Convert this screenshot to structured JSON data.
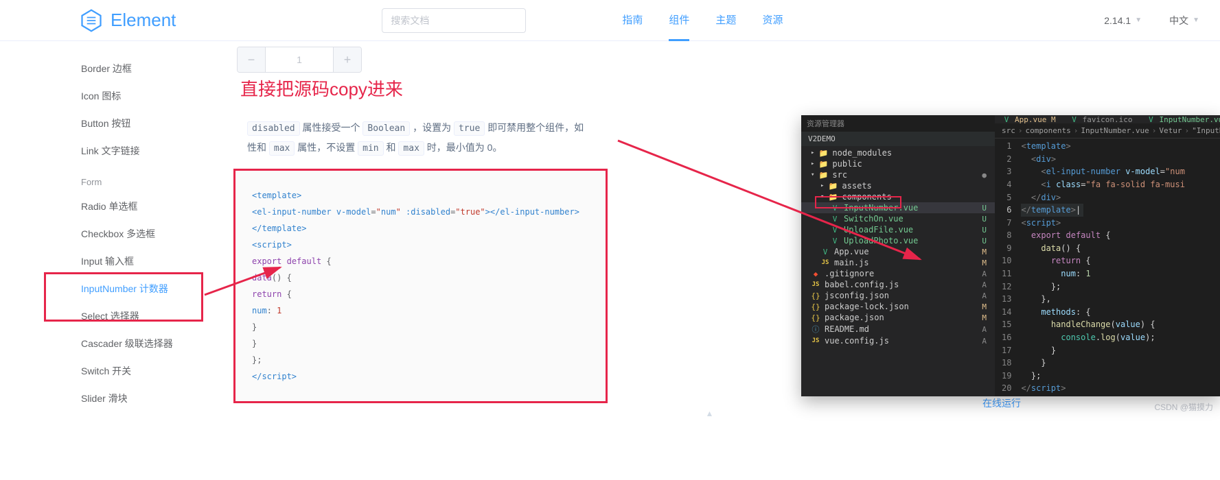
{
  "header": {
    "brand": "Element",
    "search_placeholder": "搜索文档",
    "nav": [
      {
        "label": "指南",
        "active": false
      },
      {
        "label": "组件",
        "active": true
      },
      {
        "label": "主题",
        "active": false
      },
      {
        "label": "资源",
        "active": false
      }
    ],
    "version": "2.14.1",
    "language": "中文"
  },
  "sidebar": {
    "items": [
      {
        "label": "Border 边框",
        "type": "item"
      },
      {
        "label": "Icon 图标",
        "type": "item"
      },
      {
        "label": "Button 按钮",
        "type": "item"
      },
      {
        "label": "Link 文字链接",
        "type": "item"
      },
      {
        "label": "Form",
        "type": "group"
      },
      {
        "label": "Radio 单选框",
        "type": "item"
      },
      {
        "label": "Checkbox 多选框",
        "type": "item"
      },
      {
        "label": "Input 输入框",
        "type": "item"
      },
      {
        "label": "InputNumber 计数器",
        "type": "item",
        "active": true
      },
      {
        "label": "Select 选择器",
        "type": "item"
      },
      {
        "label": "Cascader 级联选择器",
        "type": "item"
      },
      {
        "label": "Switch 开关",
        "type": "item"
      },
      {
        "label": "Slider 滑块",
        "type": "item"
      }
    ]
  },
  "main": {
    "counter_value": "1",
    "desc_parts": {
      "p1": "属性接受一个",
      "p2": "，设置为",
      "p3": "即可禁用整个组件，如",
      "p4": "性和",
      "p5": "属性，不设置",
      "p6": "和",
      "p7": "时，最小值为 0。",
      "c_disabled": "disabled",
      "c_boolean": "Boolean",
      "c_true": "true",
      "c_max": "max",
      "c_min": "min",
      "c_max2": "max"
    },
    "code_lines": [
      "<template>",
      "  <el-input-number v-model=\"num\" :disabled=\"true\"></el-input-number>",
      "</template>",
      "<script>",
      "  export default {",
      "    data() {",
      "      return {",
      "        num: 1",
      "      }",
      "    }",
      "  };",
      "</script>"
    ],
    "online_run": "在线运行",
    "csdn": "CSDN @猫摸力"
  },
  "annotation": {
    "title": "直接把源码copy进来"
  },
  "vscode": {
    "title_hint": "资源管理器",
    "project": "V2DEMO",
    "tree": [
      {
        "name": "node_modules",
        "icon": "folder",
        "indent": 1,
        "expand": "▸"
      },
      {
        "name": "public",
        "icon": "folder",
        "indent": 1,
        "expand": "▸"
      },
      {
        "name": "src",
        "icon": "folder",
        "indent": 1,
        "expand": "▾",
        "badge": "●"
      },
      {
        "name": "assets",
        "icon": "folder",
        "indent": 2,
        "expand": "▸"
      },
      {
        "name": "components",
        "icon": "folder",
        "indent": 2,
        "expand": "▾"
      },
      {
        "name": "InputNumber.vue",
        "icon": "vue",
        "indent": 3,
        "status": "u",
        "badge": "U",
        "selected": true
      },
      {
        "name": "SwitchOn.vue",
        "icon": "vue",
        "indent": 3,
        "status": "u",
        "badge": "U"
      },
      {
        "name": "UploadFile.vue",
        "icon": "vue",
        "indent": 3,
        "status": "u",
        "badge": "U"
      },
      {
        "name": "UploadPhoto.vue",
        "icon": "vue",
        "indent": 3,
        "status": "u",
        "badge": "U"
      },
      {
        "name": "App.vue",
        "icon": "vue",
        "indent": 2,
        "status": "m",
        "badge": "M"
      },
      {
        "name": "main.js",
        "icon": "js",
        "indent": 2,
        "status": "m",
        "badge": "M"
      },
      {
        "name": ".gitignore",
        "icon": "git",
        "indent": 1,
        "status": "a",
        "badge": "A"
      },
      {
        "name": "babel.config.js",
        "icon": "js",
        "indent": 1,
        "status": "a",
        "badge": "A"
      },
      {
        "name": "jsconfig.json",
        "icon": "json",
        "indent": 1,
        "status": "a",
        "badge": "A"
      },
      {
        "name": "package-lock.json",
        "icon": "json",
        "indent": 1,
        "status": "m",
        "badge": "M"
      },
      {
        "name": "package.json",
        "icon": "json",
        "indent": 1,
        "status": "m",
        "badge": "M"
      },
      {
        "name": "README.md",
        "icon": "info",
        "indent": 1,
        "status": "a",
        "badge": "A"
      },
      {
        "name": "vue.config.js",
        "icon": "js",
        "indent": 1,
        "status": "a",
        "badge": "A"
      }
    ],
    "tabs": [
      {
        "label": "App.vue",
        "status": "m"
      },
      {
        "label": "favicon.ico",
        "status": ""
      },
      {
        "label": "InputNumber.vue",
        "status": "u"
      }
    ],
    "breadcrumb": [
      "src",
      "components",
      "InputNumber.vue",
      "Vetur",
      "\"InputNumb"
    ],
    "code": [
      {
        "n": 1,
        "html": "<span class='c-tag'>&lt;</span><span class='c-el'>template</span><span class='c-tag'>&gt;</span>"
      },
      {
        "n": 2,
        "html": "  <span class='c-tag'>&lt;</span><span class='c-el'>div</span><span class='c-tag'>&gt;</span>"
      },
      {
        "n": 3,
        "html": "    <span class='c-tag'>&lt;</span><span class='c-el'>el-input-number</span> <span class='c-attr'>v-model</span><span class='c-plain'>=</span><span class='c-str'>\"num</span>"
      },
      {
        "n": 4,
        "html": "    <span class='c-tag'>&lt;</span><span class='c-el'>i</span> <span class='c-attr'>class</span><span class='c-plain'>=</span><span class='c-str'>\"fa fa-solid fa-musi</span>"
      },
      {
        "n": 5,
        "html": "  <span class='c-tag'>&lt;/</span><span class='c-el'>div</span><span class='c-tag'>&gt;</span>"
      },
      {
        "n": 6,
        "html": "<span class='vsc-sel-line'><span class='c-tag'>&lt;/</span><span class='c-el'>template</span><span class='c-tag'>&gt;</span><span class='c-plain'>|</span></span>"
      },
      {
        "n": 7,
        "html": "<span class='c-tag'>&lt;</span><span class='c-el'>script</span><span class='c-tag'>&gt;</span>"
      },
      {
        "n": 8,
        "html": "  <span class='c-kw'>export</span> <span class='c-kw'>default</span> <span class='c-plain'>{</span>"
      },
      {
        "n": 9,
        "html": "    <span class='c-fn'>data</span><span class='c-plain'>() {</span>"
      },
      {
        "n": 10,
        "html": "      <span class='c-kw'>return</span> <span class='c-plain'>{</span>"
      },
      {
        "n": 11,
        "html": "        <span class='c-prop'>num</span><span class='c-plain'>:</span> <span class='c-num'>1</span>"
      },
      {
        "n": 12,
        "html": "      <span class='c-plain'>};</span>"
      },
      {
        "n": 13,
        "html": "    <span class='c-plain'>},</span>"
      },
      {
        "n": 14,
        "html": "    <span class='c-prop'>methods</span><span class='c-plain'>: {</span>"
      },
      {
        "n": 15,
        "html": "      <span class='c-fn'>handleChange</span><span class='c-plain'>(</span><span class='c-var'>value</span><span class='c-plain'>) {</span>"
      },
      {
        "n": 16,
        "html": "        <span class='c-cls'>console</span><span class='c-plain'>.</span><span class='c-fn'>log</span><span class='c-plain'>(</span><span class='c-var'>value</span><span class='c-plain'>);</span>"
      },
      {
        "n": 17,
        "html": "      <span class='c-plain'>}</span>"
      },
      {
        "n": 18,
        "html": "    <span class='c-plain'>}</span>"
      },
      {
        "n": 19,
        "html": "  <span class='c-plain'>};</span>"
      },
      {
        "n": 20,
        "html": "<span class='c-tag'>&lt;/</span><span class='c-el'>script</span><span class='c-tag'>&gt;</span>"
      }
    ]
  }
}
